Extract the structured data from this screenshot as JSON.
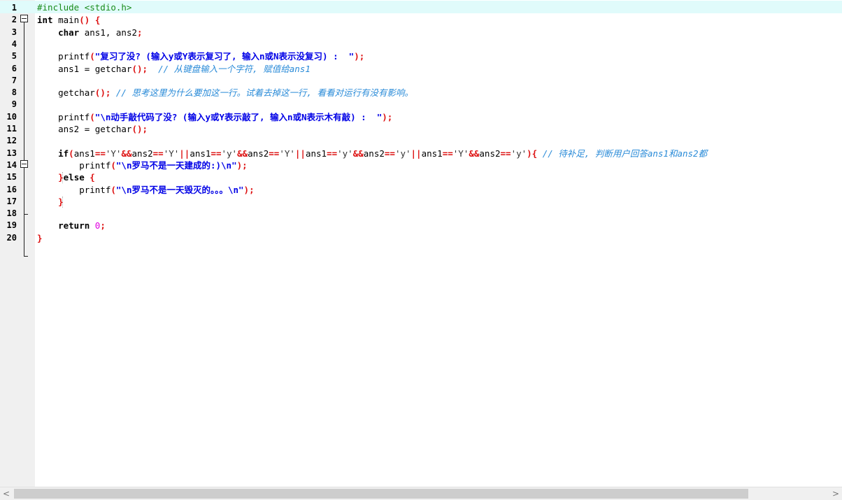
{
  "editor": {
    "lines": [
      {
        "n": "1",
        "tokens": [
          [
            "pp",
            "#include <stdio.h>"
          ]
        ]
      },
      {
        "n": "2",
        "tokens": [
          [
            "kw",
            "int"
          ],
          [
            "plain",
            " main"
          ],
          [
            "sym",
            "()"
          ],
          [
            "plain",
            " "
          ],
          [
            "sym",
            "{"
          ]
        ]
      },
      {
        "n": "3",
        "tokens": [
          [
            "plain",
            "    "
          ],
          [
            "kw",
            "char"
          ],
          [
            "plain",
            " ans1, ans2"
          ],
          [
            "sym",
            ";"
          ]
        ]
      },
      {
        "n": "4",
        "tokens": []
      },
      {
        "n": "5",
        "tokens": [
          [
            "plain",
            "    printf"
          ],
          [
            "sym",
            "("
          ],
          [
            "str",
            "\"复习了没? (输入y或Y表示复习了, 输入n或N表示没复习) :  \""
          ],
          [
            "sym",
            ");"
          ]
        ]
      },
      {
        "n": "6",
        "tokens": [
          [
            "plain",
            "    ans1 = getchar"
          ],
          [
            "sym",
            "();"
          ],
          [
            "plain",
            "  "
          ],
          [
            "cm",
            "// 从键盘输入一个字符, 赋值给ans1"
          ]
        ]
      },
      {
        "n": "7",
        "tokens": []
      },
      {
        "n": "8",
        "tokens": [
          [
            "plain",
            "    getchar"
          ],
          [
            "sym",
            "();"
          ],
          [
            "plain",
            " "
          ],
          [
            "cm",
            "// 思考这里为什么要加这一行。试着去掉这一行, 看看对运行有没有影响。"
          ]
        ]
      },
      {
        "n": "9",
        "tokens": []
      },
      {
        "n": "10",
        "tokens": [
          [
            "plain",
            "    printf"
          ],
          [
            "sym",
            "("
          ],
          [
            "str",
            "\"\\n动手敲代码了没? (输入y或Y表示敲了, 输入n或N表示木有敲) :  \""
          ],
          [
            "sym",
            ");"
          ]
        ]
      },
      {
        "n": "11",
        "tokens": [
          [
            "plain",
            "    ans2 = getchar"
          ],
          [
            "sym",
            "();"
          ]
        ]
      },
      {
        "n": "12",
        "tokens": []
      },
      {
        "n": "13",
        "tokens": [
          [
            "plain",
            "    "
          ],
          [
            "kw",
            "if"
          ],
          [
            "sym",
            "("
          ],
          [
            "plain",
            "ans1"
          ],
          [
            "sym",
            "=="
          ],
          [
            "chr",
            "'Y'"
          ],
          [
            "sym",
            "&&"
          ],
          [
            "plain",
            "ans2"
          ],
          [
            "sym",
            "=="
          ],
          [
            "chr",
            "'Y'"
          ],
          [
            "sym",
            "||"
          ],
          [
            "plain",
            "ans1"
          ],
          [
            "sym",
            "=="
          ],
          [
            "chr",
            "'y'"
          ],
          [
            "sym",
            "&&"
          ],
          [
            "plain",
            "ans2"
          ],
          [
            "sym",
            "=="
          ],
          [
            "chr",
            "'Y'"
          ],
          [
            "sym",
            "||"
          ],
          [
            "plain",
            "ans1"
          ],
          [
            "sym",
            "=="
          ],
          [
            "chr",
            "'y'"
          ],
          [
            "sym",
            "&&"
          ],
          [
            "plain",
            "ans2"
          ],
          [
            "sym",
            "=="
          ],
          [
            "chr",
            "'y'"
          ],
          [
            "sym",
            "||"
          ],
          [
            "plain",
            "ans1"
          ],
          [
            "sym",
            "=="
          ],
          [
            "chr",
            "'Y'"
          ],
          [
            "sym",
            "&&"
          ],
          [
            "plain",
            "ans2"
          ],
          [
            "sym",
            "=="
          ],
          [
            "chr",
            "'y'"
          ],
          [
            "sym",
            "){"
          ],
          [
            "plain",
            " "
          ],
          [
            "cm",
            "// 待补足, 判断用户回答ans1和ans2都"
          ]
        ]
      },
      {
        "n": "14",
        "tokens": [
          [
            "plain",
            "        printf"
          ],
          [
            "sym",
            "("
          ],
          [
            "str",
            "\"\\n罗马不是一天建成的:)\\n\""
          ],
          [
            "sym",
            ");"
          ]
        ]
      },
      {
        "n": "15",
        "tokens": [
          [
            "plain",
            "    "
          ],
          [
            "sym",
            "}"
          ],
          [
            "kw",
            "else"
          ],
          [
            "plain",
            " "
          ],
          [
            "sym",
            "{"
          ]
        ]
      },
      {
        "n": "16",
        "tokens": [
          [
            "plain",
            "        printf"
          ],
          [
            "sym",
            "("
          ],
          [
            "str",
            "\"\\n罗马不是一天毁灭的。。。\\n\""
          ],
          [
            "sym",
            ");"
          ]
        ]
      },
      {
        "n": "17",
        "tokens": [
          [
            "plain",
            "    "
          ],
          [
            "sym",
            "}"
          ]
        ]
      },
      {
        "n": "18",
        "tokens": []
      },
      {
        "n": "19",
        "tokens": [
          [
            "plain",
            "    "
          ],
          [
            "kw",
            "return"
          ],
          [
            "plain",
            " "
          ],
          [
            "num",
            "0"
          ],
          [
            "sym",
            ";"
          ]
        ]
      },
      {
        "n": "20",
        "tokens": [
          [
            "sym",
            "}"
          ]
        ]
      }
    ]
  },
  "scrollbar": {
    "left_arrow": "<",
    "right_arrow": ">"
  }
}
